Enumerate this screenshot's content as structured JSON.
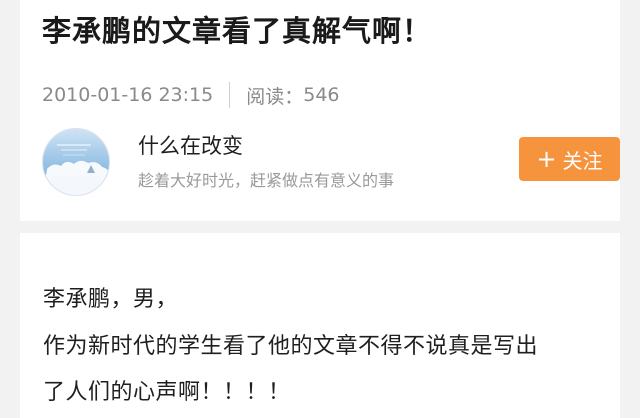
{
  "article": {
    "title": "李承鹏的文章看了真解气啊！",
    "date": "2010-01-16 23:15",
    "views_label": "阅读：",
    "views_count": "546"
  },
  "author": {
    "name": "什么在改变",
    "bio": "趁着大好时光，赶紧做点有意义的事",
    "avatar_icon": "sky-cloud-avatar"
  },
  "follow_button": {
    "icon": "plus-icon",
    "label": "关注",
    "color": "#f5943c"
  },
  "content": {
    "lines": [
      "李承鹏，男，",
      "作为新时代的学生看了他的文章不得不说真是写出",
      "了人们的心声啊！！！！"
    ]
  }
}
